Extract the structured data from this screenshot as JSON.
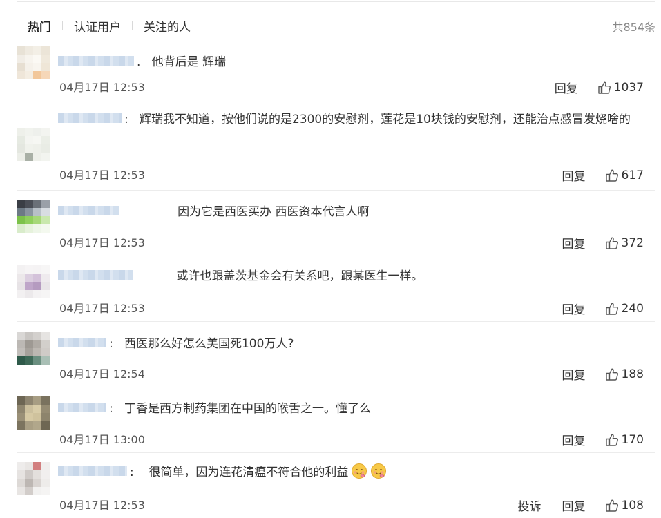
{
  "tabs": {
    "hot": "热门",
    "verified": "认证用户",
    "following": "关注的人"
  },
  "total": "共854条",
  "reply_label": "回复",
  "report_label": "投诉",
  "comments": [
    {
      "sep": ".",
      "text": "他背后是 辉瑞",
      "time": "04月17日 12:53",
      "likes": "1037"
    },
    {
      "sep": ":",
      "text": "辉瑞我不知道，按他们说的是2300的安慰剂，莲花是10块钱的安慰剂，还能治点感冒发烧啥的",
      "time": "04月17日 12:53",
      "likes": "617"
    },
    {
      "sep": "",
      "text": "因为它是西医买办 西医资本代言人啊",
      "time": "04月17日 12:53",
      "likes": "372"
    },
    {
      "sep": "",
      "text": "或许也跟盖茨基金会有关系吧，跟某医生一样。",
      "time": "04月17日 12:53",
      "likes": "240"
    },
    {
      "sep": ":",
      "text": "西医那么好怎么美国死100万人?",
      "time": "04月17日 12:54",
      "likes": "188"
    },
    {
      "sep": ":",
      "text": "丁香是西方制药集团在中国的喉舌之一。懂了么",
      "time": "04月17日 13:00",
      "likes": "170"
    },
    {
      "sep": ":",
      "text": "很简单，因为连花清瘟不符合他的利益",
      "time": "04月17日 12:53",
      "likes": "108"
    }
  ]
}
